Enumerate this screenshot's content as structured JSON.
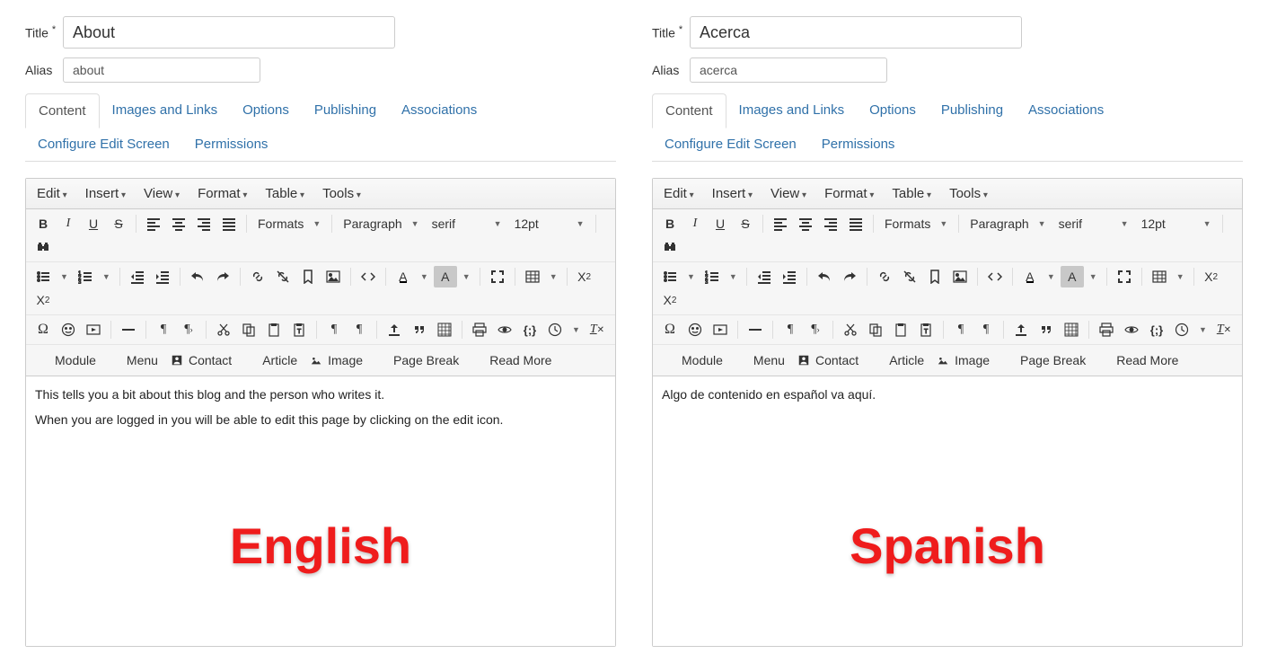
{
  "labels": {
    "title": "Title",
    "alias": "Alias",
    "required": "*"
  },
  "tabs": [
    "Content",
    "Images and Links",
    "Options",
    "Publishing",
    "Associations",
    "Configure Edit Screen",
    "Permissions"
  ],
  "menubar": [
    "Edit",
    "Insert",
    "View",
    "Format",
    "Table",
    "Tools"
  ],
  "toolbar": {
    "formats": "Formats",
    "paragraph": "Paragraph",
    "fontfamily": "serif",
    "fontsize": "12pt",
    "module": "Module",
    "menu": "Menu",
    "contact": "Contact",
    "article": "Article",
    "image": "Image",
    "pagebreak": "Page Break",
    "readmore": "Read More"
  },
  "panes": {
    "left": {
      "title": "About",
      "alias": "about",
      "body": [
        "This tells you a bit about this blog and the person who writes it.",
        "When you are logged in you will be able to edit this page by clicking on the edit icon."
      ],
      "overlay": "English"
    },
    "right": {
      "title": "Acerca",
      "alias": "acerca",
      "body": [
        "Algo de contenido en español va aquí."
      ],
      "overlay": "Spanish"
    }
  }
}
